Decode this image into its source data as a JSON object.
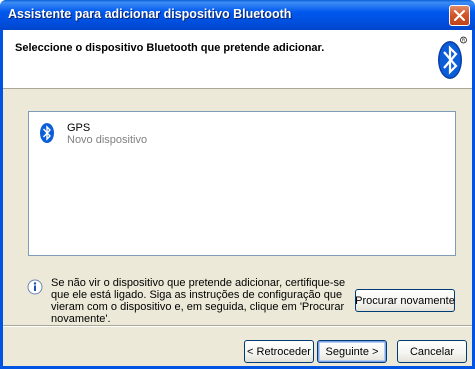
{
  "window": {
    "title": "Assistente para adicionar dispositivo Bluetooth",
    "close_icon": "close-icon"
  },
  "header": {
    "instruction": "Seleccione o dispositivo Bluetooth que pretende adicionar.",
    "logo_icon": "bluetooth-logo"
  },
  "device_list": {
    "items": [
      {
        "name": "GPS",
        "status": "Novo dispositivo",
        "icon": "bluetooth-icon"
      }
    ]
  },
  "info": {
    "icon": "info-icon",
    "text": "Se não vir o dispositivo que pretende adicionar, certifique-se que ele está ligado. Siga as instruções de configuração que vieram com o dispositivo e, em seguida, clique em 'Procurar novamente'."
  },
  "buttons": {
    "search_again": "Procurar novamente",
    "back": "< Retroceder",
    "next": "Seguinte >",
    "cancel": "Cancelar"
  },
  "colors": {
    "titlebar": "#0054e3",
    "dialog_bg": "#ece9d8",
    "bluetooth_blue": "#0b5ed7",
    "status_gray": "#808080"
  }
}
